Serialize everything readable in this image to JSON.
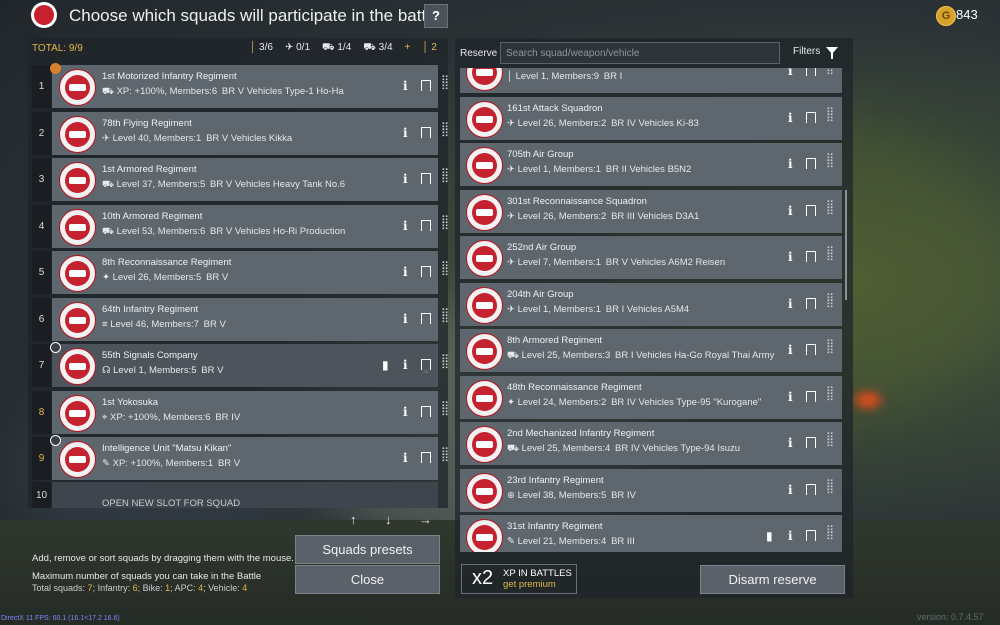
{
  "header": {
    "title": "Choose which squads will participate in the battle",
    "help_label": "?",
    "gold_icon": "G",
    "gold": "843"
  },
  "left": {
    "total": "TOTAL: 9/9",
    "counts": [
      "3/6",
      "0/1",
      "1/4",
      "3/4",
      "+",
      "2"
    ],
    "squads": [
      {
        "num": "1",
        "name": "1st Motorized Infantry Regiment",
        "info": "XP: +100%, Members:6 BR V  Vehicles Type-1 Ho-Ha"
      },
      {
        "num": "2",
        "name": "78th Flying Regiment",
        "info": "Level 40, Members:1 BR V  Vehicles Kikka"
      },
      {
        "num": "3",
        "name": "1st Armored Regiment",
        "info": "Level 37, Members:5 BR V  Vehicles Heavy Tank No.6"
      },
      {
        "num": "4",
        "name": "10th Armored Regiment",
        "info": "Level 53, Members:6 BR V  Vehicles Ho-Ri Production"
      },
      {
        "num": "5",
        "name": "8th Reconnaissance Regiment",
        "info": "Level 26, Members:5 BR V"
      },
      {
        "num": "6",
        "name": "64th Infantry Regiment",
        "info": "Level 46, Members:7 BR V"
      },
      {
        "num": "7",
        "name": "55th Signals Company",
        "info": "Level 1, Members:5 BR V"
      },
      {
        "num": "8",
        "name": "1st Yokosuka",
        "info": "XP: +100%, Members:6 BR IV"
      },
      {
        "num": "9",
        "name": "Intelligence Unit \"Matsu Kikan\"",
        "info": "XP: +100%, Members:1 BR V"
      }
    ],
    "new_slot": {
      "num": "10",
      "label": "OPEN NEW SLOT FOR SQUAD"
    },
    "arrows": [
      "↑",
      "↓",
      "→"
    ],
    "hint1": "Add, remove or sort squads by dragging them with the mouse.",
    "hint2": "Maximum number of squads you can take in the Battle",
    "hint3_prefix": "Total squads: ",
    "hint3_total": "7",
    "hint3_inf_label": "; Infantry: ",
    "hint3_inf": "6",
    "hint3_bike_label": "; Bike: ",
    "hint3_bike": "1",
    "hint3_apc_label": "; APC: ",
    "hint3_apc": "4",
    "hint3_veh_label": "; Vehicle: ",
    "hint3_veh": "4",
    "presets_label": "Squads presets",
    "close_label": "Close"
  },
  "right": {
    "reserve_label": "Reserve",
    "search_placeholder": "Search squad/weapon/vehicle",
    "filters_label": "Filters",
    "squads": [
      {
        "name": "",
        "info": "Level 1, Members:9 BR I"
      },
      {
        "name": "161st Attack Squadron",
        "info": "Level 26, Members:2 BR IV  Vehicles Ki-83"
      },
      {
        "name": "705th Air Group",
        "info": "Level 1, Members:1 BR II  Vehicles B5N2"
      },
      {
        "name": "301st Reconnaissance Squadron",
        "info": "Level 26, Members:2 BR III  Vehicles D3A1"
      },
      {
        "name": "252nd Air Group",
        "info": "Level 7, Members:1 BR V  Vehicles A6M2 Reisen"
      },
      {
        "name": "204th Air Group",
        "info": "Level 1, Members:1 BR I  Vehicles A5M4"
      },
      {
        "name": "8th Armored Regiment",
        "info": "Level 25, Members:3 BR I  Vehicles Ha-Go Royal Thai Army"
      },
      {
        "name": "48th Reconnaissance Regiment",
        "info": "Level 24, Members:2 BR IV  Vehicles Type-95 \"Kurogane\""
      },
      {
        "name": "2nd Mechanized Infantry Regiment",
        "info": "Level 25, Members:4 BR IV  Vehicles Type-94 Isuzu"
      },
      {
        "name": "23rd Infantry Regiment",
        "info": "Level 38, Members:5 BR IV"
      },
      {
        "name": "31st Infantry Regiment",
        "info": "Level 21, Members:4 BR III"
      }
    ],
    "xp_mult": "x2",
    "xp_line1": "XP IN BATTLES",
    "xp_line2": "get premium",
    "disarm_label": "Disarm reserve"
  },
  "footer": {
    "version": "version: 0.7.4.57",
    "directx": "DirectX 11 FPS: 60.1 (16.1<17.2 16.6)"
  }
}
